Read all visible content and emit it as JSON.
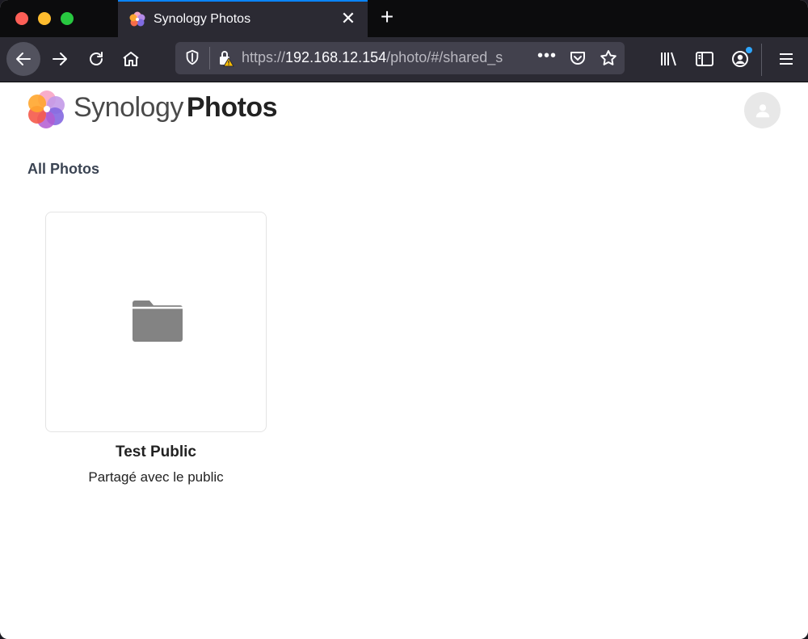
{
  "browser": {
    "tab": {
      "title": "Synology Photos"
    },
    "url": {
      "scheme": "https://",
      "host": "192.168.12.154",
      "path": "/photo/#/shared_s"
    }
  },
  "app": {
    "brand_light": "Synology",
    "brand_bold": "Photos"
  },
  "main": {
    "section_title": "All Photos",
    "albums": [
      {
        "title": "Test Public",
        "subtitle": "Partagé avec le public",
        "icon": "folder-icon"
      }
    ]
  },
  "colors": {
    "accent": "#0a84ff",
    "folder": "#838383"
  }
}
